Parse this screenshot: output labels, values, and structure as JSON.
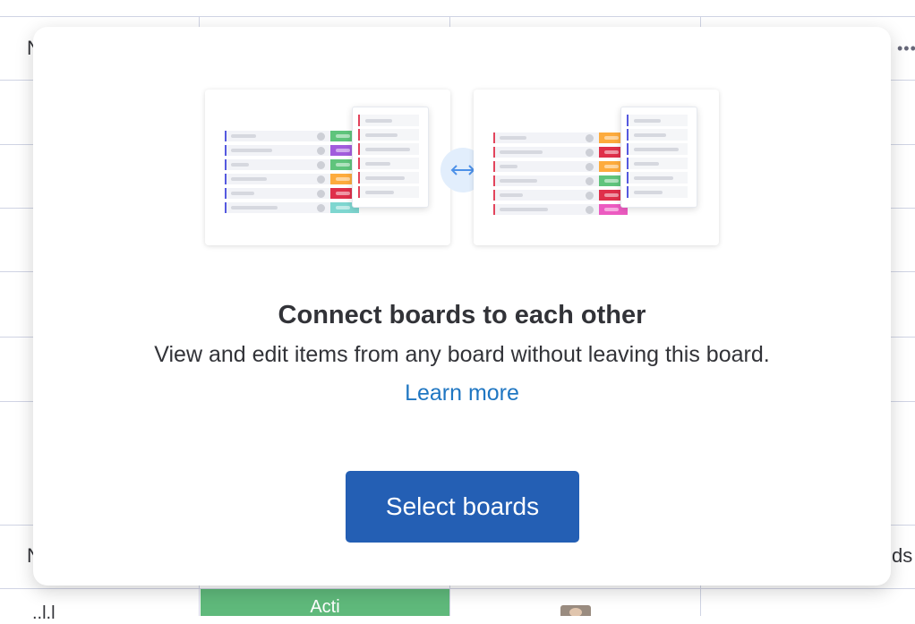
{
  "background": {
    "header_fragment_1": "N",
    "header_fragment_2": "N",
    "right_fragment": "ds",
    "status_fragment": "Acti",
    "bottom_left_fragment": "..l.l",
    "more_icon": "more-horizontal-icon"
  },
  "modal": {
    "title": "Connect boards to each other",
    "subtitle": "View and edit items from any board without leaving this board.",
    "learn_more": "Learn more",
    "primary_button": "Select boards",
    "illustration_icon": "bidirectional-arrow-icon"
  },
  "colors": {
    "accent_blue": "#245fb4",
    "link_blue": "#1f76c2",
    "status_green": "#5fb97b",
    "board_left_accent": "#5559df",
    "board_right_accent": "#e2445c",
    "label_green": "#5fc47c",
    "label_purple": "#a25ddc",
    "label_orange": "#fdab3d",
    "label_red": "#df2f4a",
    "label_teal": "#7ed6d0",
    "label_pink": "#ec5bc1"
  }
}
